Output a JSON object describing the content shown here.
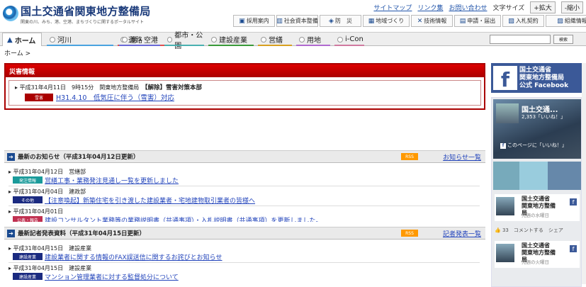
{
  "header": {
    "title": "国土交通省関東地方整備局",
    "subtitle": "関東の川、みち、港、空港、まちづくりに関するポータルサイト",
    "links": [
      "サイトマップ",
      "リンク集",
      "お問い合わせ"
    ],
    "font_size_label": "文字サイズ",
    "enlarge": "+拡大",
    "shrink": "-縮小",
    "quick_buttons": [
      "採用案内",
      "社会資本整備",
      "防　災",
      "地域づくり",
      "技術情報",
      "申請・届出",
      "入札契約",
      "組織情報"
    ]
  },
  "nav": {
    "home": "ホーム",
    "items": [
      {
        "label": "河川",
        "color": "#4aa3df"
      },
      {
        "label": "道路",
        "color": "#e05050"
      },
      {
        "label": "港・空港",
        "color": "#6a6ad8"
      },
      {
        "label": "都市・公園",
        "color": "#4ab0b0"
      },
      {
        "label": "建設産業",
        "color": "#3a9a3a"
      },
      {
        "label": "営繕",
        "color": "#d8a020"
      },
      {
        "label": "用地",
        "color": "#b06ad0"
      },
      {
        "label": "i-Con",
        "color": "#d07aa0"
      }
    ],
    "search_button": "検索"
  },
  "breadcrumb": "ホーム >",
  "disaster": {
    "title": "災害情報",
    "date": "平成31年4月11日　9時15分",
    "org": "関東地方整備局",
    "headline": "【解除】雪害対策本部",
    "badge": "雪害",
    "link": "H31.4.10　低気圧に伴う（雪害）対応"
  },
  "news": {
    "title": "最新のお知らせ（平成31年04月12日更新）",
    "rss": "RSS",
    "more": "お知らせ一覧",
    "items": [
      {
        "date": "平成31年04月12日",
        "org": "営繕部",
        "cat": "発注情報",
        "cat_color": "#1a9a9a",
        "title": "営繕工事・業務発注見通し一覧を更新しました"
      },
      {
        "date": "平成31年04月04日",
        "org": "建政部",
        "cat": "その他",
        "cat_color": "#1a2a80",
        "title": "【注意喚起】新築住宅を引き渡した建設業者・宅地建物取引業者の皆様へ"
      },
      {
        "date": "平成31年04月01日",
        "org": "",
        "cat": "公表・報告",
        "cat_color": "#c03050",
        "title": "建設コンサルタント業務等の業務説明書（共通事項）・入札説明書（共通事項）を更新しました。"
      }
    ]
  },
  "press": {
    "title": "最新記者発表資料（平成31年04月15日更新）",
    "rss": "RSS",
    "more": "記者発表一覧",
    "items": [
      {
        "date": "平成31年04月15日",
        "org": "建設産業",
        "cat": "建設産業",
        "cat_color": "#1a2a80",
        "title": "建設業者に関する情報のFAX誤送信に関するお詫びとお知らせ"
      },
      {
        "date": "平成31年04月15日",
        "org": "建設産業",
        "cat": "建設産業",
        "cat_color": "#1a2a80",
        "title": "マンション管理業者に対する監督処分について"
      }
    ]
  },
  "sidebar": {
    "fb_banner": [
      "国土交通省",
      "関東地方整備局",
      "公式 Facebook"
    ],
    "fb_page_name": "国土交通...",
    "fb_likes": "2,353「いいね！」",
    "fb_like_button": "このページに「いいね！」",
    "posts": [
      {
        "name": "国土交通省 関東地方整備局",
        "time": "先週の水曜日"
      },
      {
        "name": "国土交通省 関東地方整備局",
        "time": "先週の火曜日"
      }
    ],
    "actions": "33　コメントする　シェア"
  }
}
